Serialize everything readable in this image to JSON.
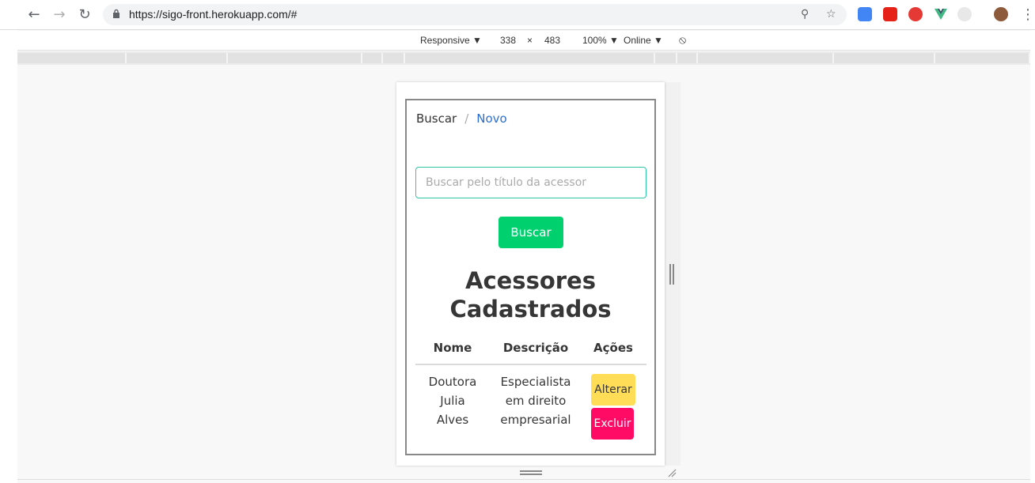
{
  "browser": {
    "url": "https://sigo-front.herokuapp.com/#",
    "back_icon": "arrow-left",
    "forward_icon": "arrow-right",
    "reload_icon": "reload"
  },
  "devtools_toolbar": {
    "device": "Responsive ▼",
    "width": "338",
    "times": "×",
    "height": "483",
    "zoom": "100% ▼",
    "network": "Online ▼"
  },
  "page": {
    "breadcrumb": {
      "first": "Buscar",
      "separator": "/",
      "second": "Novo"
    },
    "search": {
      "placeholder": "Buscar pelo título da acessor",
      "button_label": "Buscar"
    },
    "title_line1": "Acessores",
    "title_line2": "Cadastrados",
    "table": {
      "headers": [
        "Nome",
        "Descrição",
        "Ações"
      ],
      "rows": [
        {
          "nome": [
            "Doutora",
            "Julia",
            "Alves"
          ],
          "descricao": [
            "Especialista",
            "em direito",
            "empresarial"
          ],
          "alterar": "Alterar",
          "excluir": "Excluir"
        }
      ]
    }
  },
  "colors": {
    "accent_green": "#00d06e",
    "link_blue": "#2c6fd1",
    "warning_yellow": "#ffdd57",
    "danger_pink": "#ff0a64",
    "input_border": "#29c7a6"
  }
}
